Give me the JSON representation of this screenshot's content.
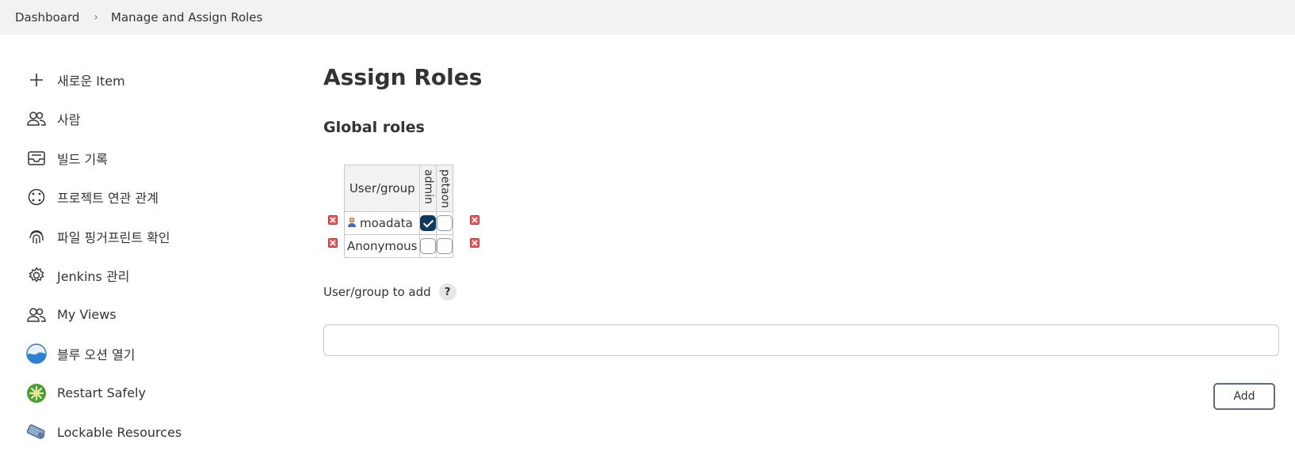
{
  "breadcrumb": {
    "items": [
      "Dashboard",
      "Manage and Assign Roles"
    ],
    "separator": "›"
  },
  "sidebar": {
    "items": [
      {
        "label": "새로운 Item",
        "icon": "plus-icon"
      },
      {
        "label": "사람",
        "icon": "people-icon"
      },
      {
        "label": "빌드 기록",
        "icon": "inbox-icon"
      },
      {
        "label": "프로젝트 연관 관계",
        "icon": "relationship-icon"
      },
      {
        "label": "파일 핑거프린트 확인",
        "icon": "fingerprint-icon"
      },
      {
        "label": "Jenkins 관리",
        "icon": "gear-icon"
      },
      {
        "label": "My Views",
        "icon": "people-icon"
      },
      {
        "label": "블루 오션 열기",
        "icon": "blue-ocean-icon"
      },
      {
        "label": "Restart Safely",
        "icon": "restart-icon"
      },
      {
        "label": "Lockable Resources",
        "icon": "lockable-resources-icon"
      }
    ]
  },
  "main": {
    "title": "Assign Roles",
    "section_title": "Global roles",
    "table": {
      "user_header": "User/group",
      "roles": [
        "admin",
        "petaon"
      ],
      "rows": [
        {
          "name": "moadata",
          "checks": [
            true,
            false
          ]
        },
        {
          "name": "Anonymous",
          "checks": [
            false,
            false
          ]
        }
      ]
    },
    "add_label": "User/group to add",
    "help_label": "?",
    "add_input_value": "",
    "add_button_label": "Add"
  },
  "colors": {
    "checkbox_checked": "#0e3a5e",
    "breadcrumb_bg": "#f2f2f2",
    "delete_red": "#e35b5b"
  }
}
